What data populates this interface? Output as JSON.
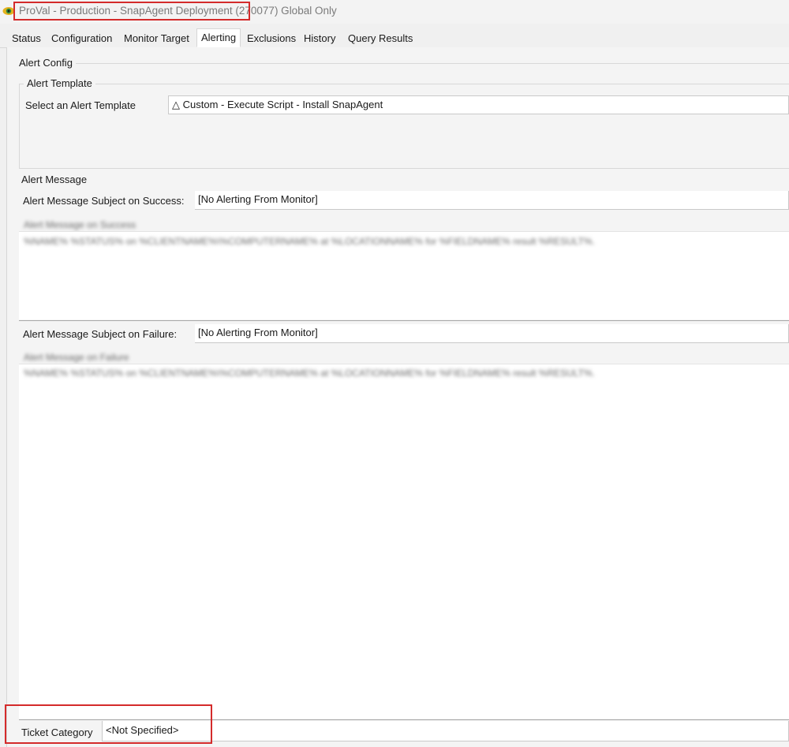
{
  "window": {
    "title": "ProVal - Production - SnapAgent Deployment (270077) Global Only"
  },
  "tabs": [
    {
      "label": "Status"
    },
    {
      "label": "Configuration"
    },
    {
      "label": "Monitor Target"
    },
    {
      "label": "Alerting",
      "active": true
    },
    {
      "label": "Exclusions"
    },
    {
      "label": "History"
    },
    {
      "label": "Query Results"
    }
  ],
  "alert_config": {
    "group_label": "Alert Config",
    "template_group_label": "Alert Template",
    "select_label": "Select an Alert Template",
    "selected_template": "△ Custom - Execute Script - Install SnapAgent"
  },
  "alert_message": {
    "section_label": "Alert Message",
    "success_subject_label": "Alert Message Subject on Success:",
    "success_subject_value": "[No Alerting From Monitor]",
    "success_body_label": "Alert Message on Success",
    "success_body_value": "%NAME% %STATUS% on %CLIENTNAME%\\%COMPUTERNAME% at %LOCATIONNAME% for %FIELDNAME% result %RESULT%.",
    "failure_subject_label": "Alert Message Subject on Failure:",
    "failure_subject_value": "[No Alerting From Monitor]",
    "failure_body_label": "Alert Message on Failure",
    "failure_body_value": "%NAME% %STATUS% on %CLIENTNAME%\\%COMPUTERNAME% at %LOCATIONNAME% for %FIELDNAME% result %RESULT%."
  },
  "ticket": {
    "label": "Ticket Category",
    "value": "<Not Specified>"
  },
  "colors": {
    "highlight": "#d42b2b",
    "background": "#f0f0f0"
  },
  "icons": {
    "app": "eye-icon"
  }
}
